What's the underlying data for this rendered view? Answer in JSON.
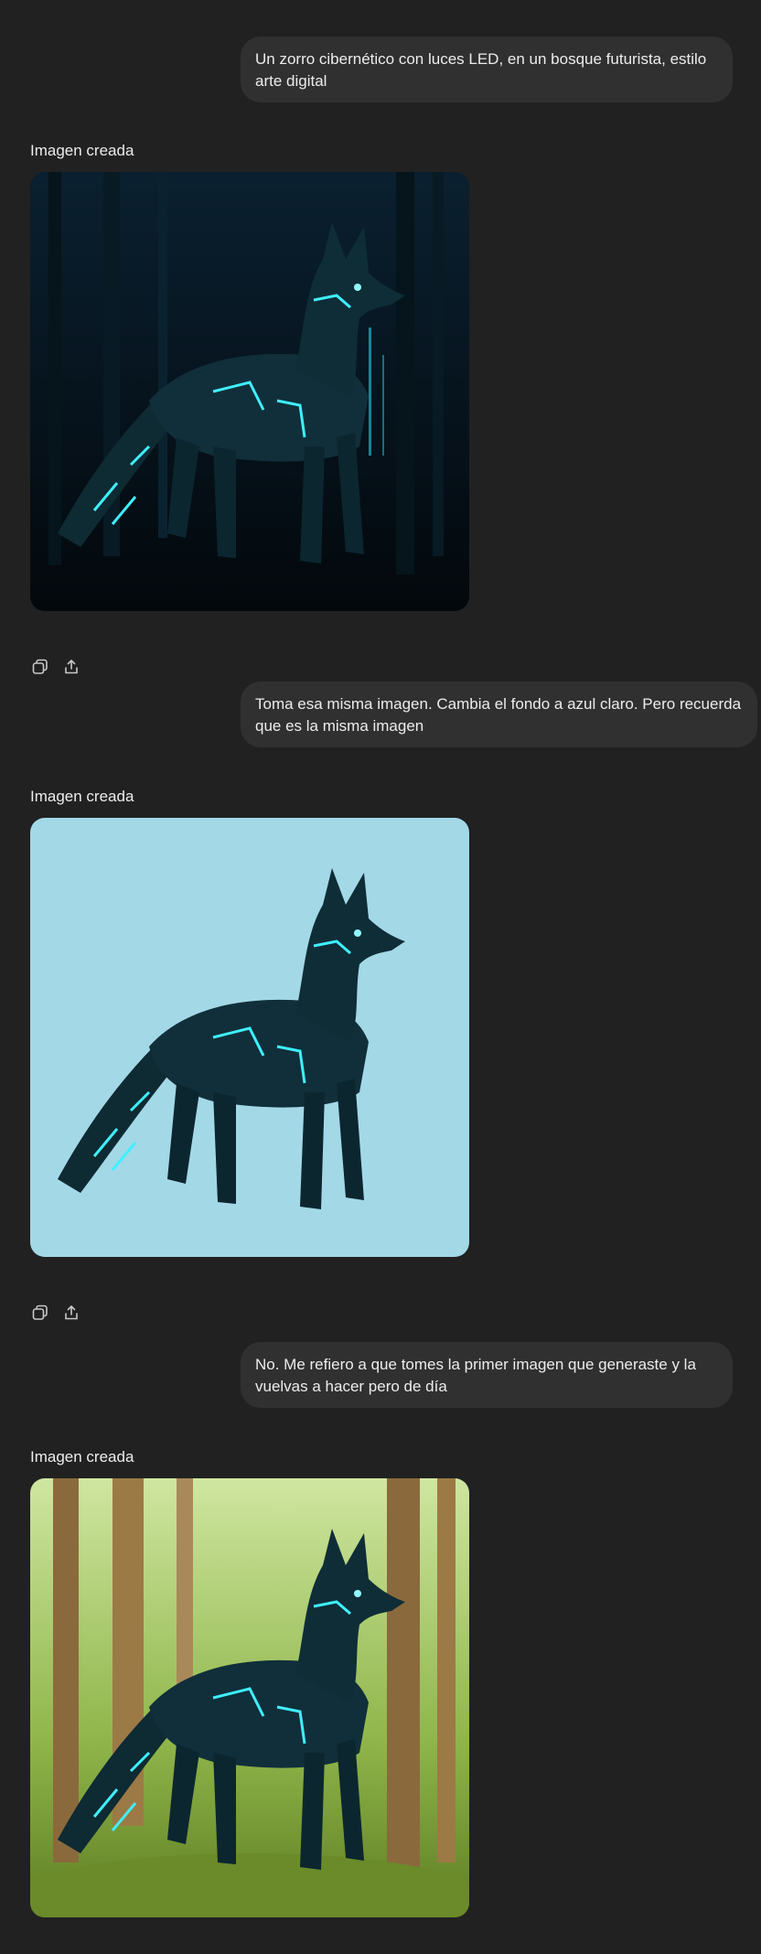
{
  "conversation": {
    "messages": [
      {
        "user_text": "Un zorro cibernético con luces LED, en un bosque futurista, estilo arte digital"
      },
      {
        "user_text": "Toma esa misma imagen. Cambia el fondo a azul claro. Pero recuerda que es la misma imagen"
      },
      {
        "user_text": "No. Me refiero a que tomes la primer imagen que generaste y la vuelvas a hacer pero de día"
      }
    ],
    "responses": [
      {
        "label": "Imagen creada",
        "image_icon": "cyber-fox-night-forest-image"
      },
      {
        "label": "Imagen creada",
        "image_icon": "cyber-fox-light-blue-image"
      },
      {
        "label": "Imagen creada",
        "image_icon": "cyber-fox-day-forest-image"
      }
    ]
  },
  "actions": {
    "copy_icon": "copy-icon",
    "share_icon": "share-icon"
  },
  "colors": {
    "background": "#212121",
    "bubble": "#303030",
    "text": "#ececec",
    "neon": "#3ff0ff",
    "light_blue_bg": "#a3d8e7"
  }
}
